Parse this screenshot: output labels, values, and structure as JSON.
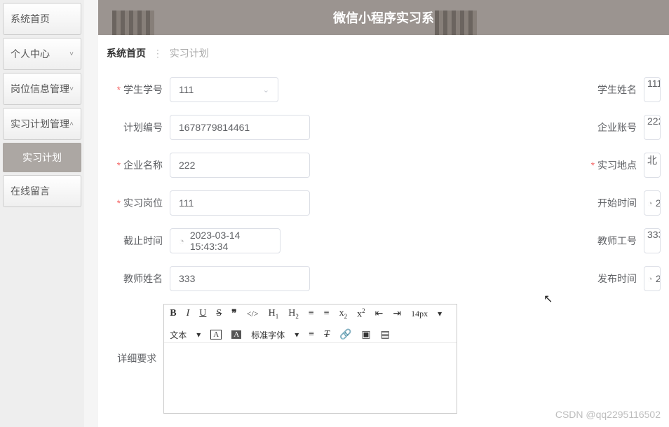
{
  "banner": {
    "title": "微信小程序实习系"
  },
  "sidebar": {
    "items": [
      {
        "label": "系统首页",
        "chev": ""
      },
      {
        "label": "个人中心",
        "chev": "˅"
      },
      {
        "label": "岗位信息管理",
        "chev": "˅"
      },
      {
        "label": "实习计划管理",
        "chev": "˄"
      }
    ],
    "sub": "实习计划",
    "last": {
      "label": "在线留言",
      "chev": ""
    }
  },
  "crumb": {
    "home": "系统首页",
    "current": "实习计划"
  },
  "form": {
    "student_id": {
      "label": "学生学号",
      "value": "111"
    },
    "student_name": {
      "label": "学生姓名",
      "value": "111"
    },
    "plan_no": {
      "label": "计划编号",
      "value": "1678779814461"
    },
    "company_acct": {
      "label": "企业账号",
      "value": "222"
    },
    "company_name": {
      "label": "企业名称",
      "value": "222"
    },
    "location": {
      "label": "实习地点",
      "value": "北"
    },
    "position": {
      "label": "实习岗位",
      "value": "111"
    },
    "start_time": {
      "label": "开始时间",
      "value": "2"
    },
    "end_time": {
      "label": "截止时间",
      "value": "2023-03-14 15:43:34"
    },
    "teacher_id": {
      "label": "教师工号",
      "value": "333"
    },
    "teacher_name": {
      "label": "教师姓名",
      "value": "333"
    },
    "publish_time": {
      "label": "发布时间",
      "value": "2"
    },
    "detail": {
      "label": "详细要求"
    }
  },
  "editor": {
    "fontsize": "14px",
    "select_text": "文本",
    "select_font": "标准字体"
  },
  "watermark": "CSDN @qq2295116502"
}
